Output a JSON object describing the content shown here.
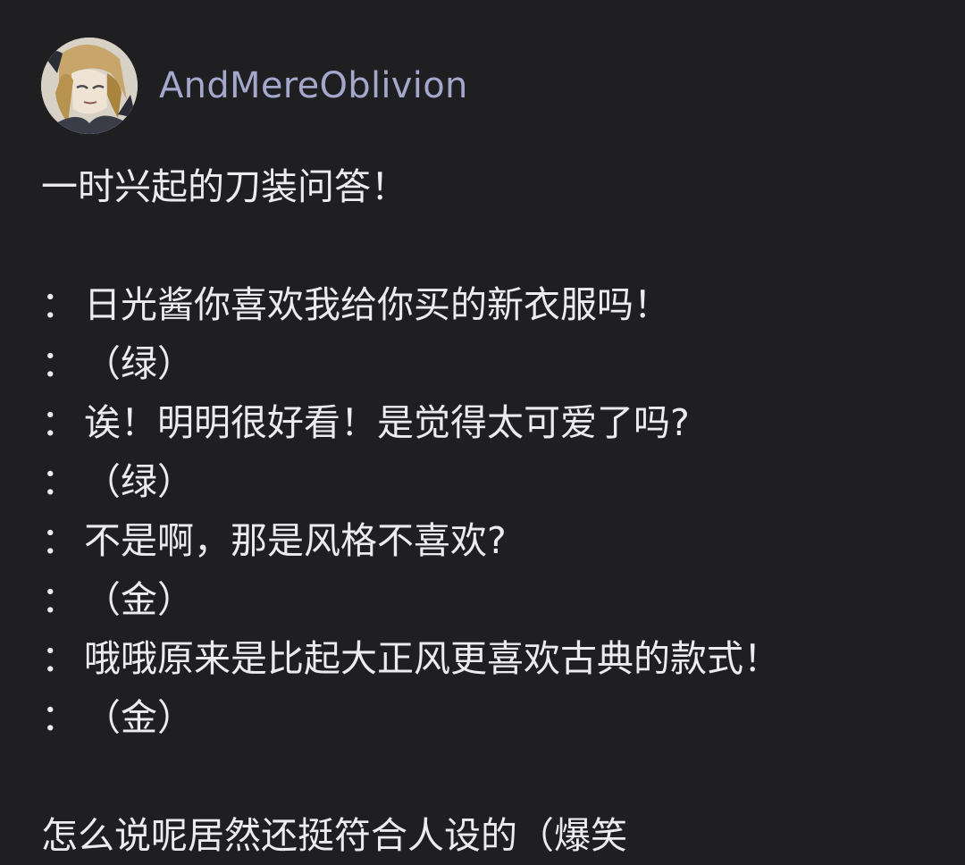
{
  "post": {
    "username": "AndMereOblivion",
    "title": "一时兴起的刀装问答！",
    "dialog": [
      {
        "colon": "：",
        "text": "日光酱你喜欢我给你买的新衣服吗！"
      },
      {
        "colon": "：",
        "text": " （绿）"
      },
      {
        "colon": "：",
        "text": "诶！明明很好看！是觉得太可爱了吗?"
      },
      {
        "colon": "：",
        "text": " （绿）"
      },
      {
        "colon": "：",
        "text": "不是啊，那是风格不喜欢?"
      },
      {
        "colon": "：",
        "text": " （金）"
      },
      {
        "colon": "：",
        "text": "哦哦原来是比起大正风更喜欢古典的款式！"
      },
      {
        "colon": "：",
        "text": " （金）"
      }
    ],
    "closing": "怎么说呢居然还挺符合人设的（爆笑"
  },
  "colors": {
    "background": "#1f1f21",
    "text": "#ececee",
    "username": "#a3a8cc"
  }
}
